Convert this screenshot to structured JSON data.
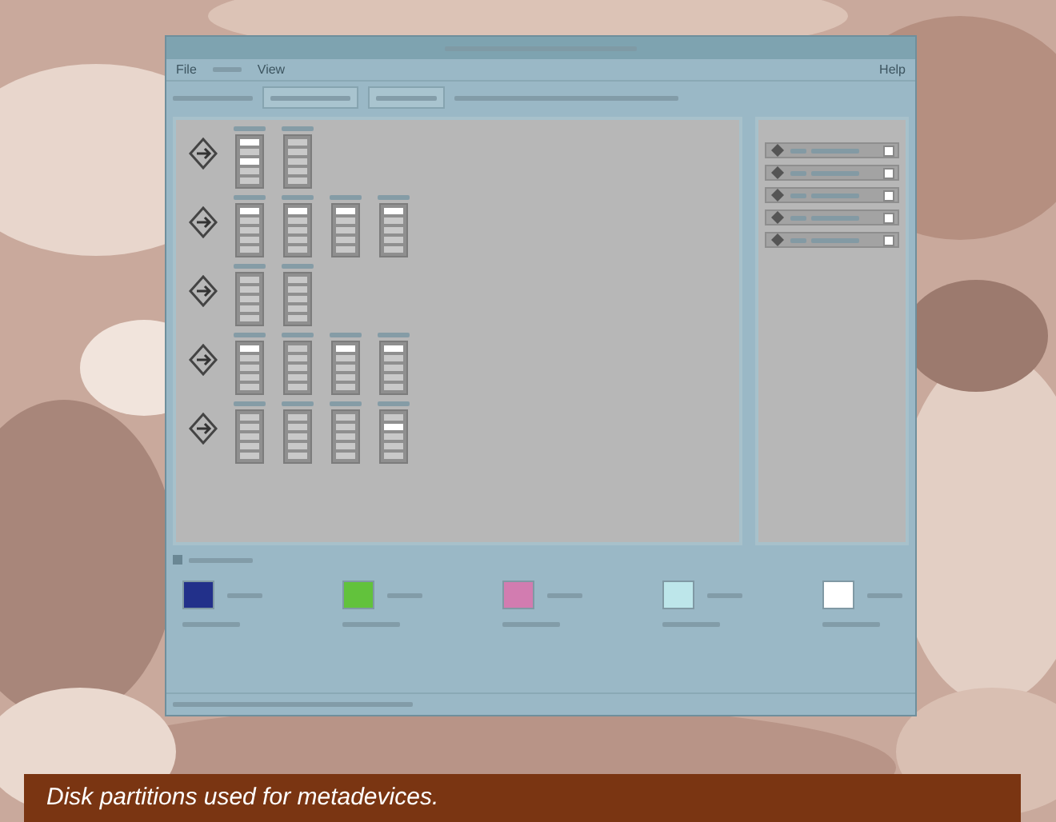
{
  "menu": [
    {
      "label": "File"
    },
    {
      "label": "View"
    }
  ],
  "help_menu": "Help",
  "controllers": [
    {
      "disks": [
        {
          "slices": [
            true,
            false,
            true,
            false,
            false
          ]
        },
        {
          "slices": [
            false,
            false,
            false,
            false,
            false
          ]
        }
      ]
    },
    {
      "disks": [
        {
          "slices": [
            true,
            false,
            false,
            false,
            false
          ]
        },
        {
          "slices": [
            true,
            false,
            false,
            false,
            false
          ]
        },
        {
          "slices": [
            true,
            false,
            false,
            false,
            false
          ]
        },
        {
          "slices": [
            true,
            false,
            false,
            false,
            false
          ]
        }
      ]
    },
    {
      "disks": [
        {
          "slices": [
            false,
            false,
            false,
            false,
            false
          ]
        },
        {
          "slices": [
            false,
            false,
            false,
            false,
            false
          ]
        }
      ]
    },
    {
      "disks": [
        {
          "slices": [
            true,
            false,
            false,
            false,
            false
          ]
        },
        {
          "slices": [
            false,
            false,
            false,
            false,
            false
          ]
        },
        {
          "slices": [
            true,
            false,
            false,
            false,
            false
          ]
        },
        {
          "slices": [
            true,
            false,
            false,
            false,
            false
          ]
        }
      ]
    },
    {
      "disks": [
        {
          "slices": [
            false,
            false,
            false,
            false,
            false
          ]
        },
        {
          "slices": [
            false,
            false,
            false,
            false,
            false
          ]
        },
        {
          "slices": [
            false,
            false,
            false,
            false,
            false
          ]
        },
        {
          "slices": [
            false,
            true,
            false,
            false,
            false
          ]
        }
      ]
    }
  ],
  "controller_list": [
    {
      "checked": false
    },
    {
      "checked": false
    },
    {
      "checked": false
    },
    {
      "checked": false
    },
    {
      "checked": false
    }
  ],
  "show_legend": {
    "checked": true
  },
  "legend": [
    {
      "color": "#22308a"
    },
    {
      "color": "#62c23c"
    },
    {
      "color": "#d27cb0"
    },
    {
      "color": "#bde6ea"
    },
    {
      "color": "#ffffff"
    }
  ],
  "caption": "Disk partitions used for metadevices."
}
